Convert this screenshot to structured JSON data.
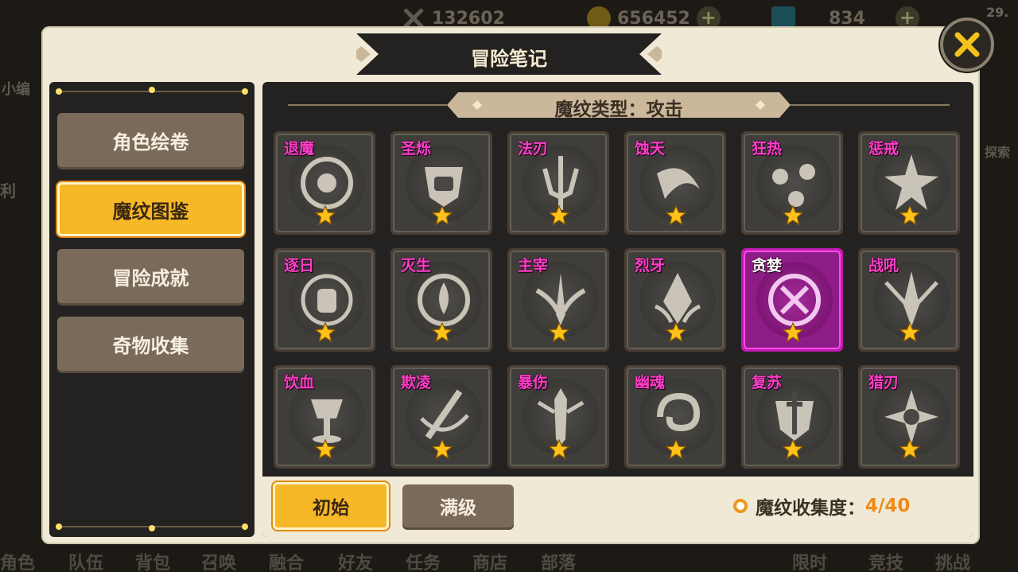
{
  "background": {
    "resources": [
      {
        "icon": "crossed-swords-icon",
        "value": "132602"
      },
      {
        "icon": "coin-icon",
        "value": "656452"
      },
      {
        "icon": "gem-icon",
        "value": "834"
      }
    ],
    "top_right_text": "29.",
    "left_texts": [
      "小编",
      "利"
    ],
    "right_text": "探索",
    "bottom_nav": [
      "角色",
      "队伍",
      "背包",
      "召唤",
      "融合",
      "好友",
      "任务",
      "商店",
      "部落",
      "限时",
      "竞技",
      "挑战"
    ]
  },
  "dialog": {
    "title": "冒险笔记",
    "close_icon": "crossed-swords-close-icon",
    "menu": [
      {
        "label": "角色绘卷",
        "active": false
      },
      {
        "label": "魔纹图鉴",
        "active": true
      },
      {
        "label": "冒险成就",
        "active": false
      },
      {
        "label": "奇物收集",
        "active": false
      }
    ],
    "type_label": "魔纹类型：攻击",
    "runes": [
      {
        "name": "退魔",
        "icon": "vortex-rune-icon",
        "stars": 1
      },
      {
        "name": "圣烁",
        "icon": "fist-shield-rune-icon",
        "stars": 1
      },
      {
        "name": "法刃",
        "icon": "trident-rune-icon",
        "stars": 1
      },
      {
        "name": "蚀天",
        "icon": "crescent-blade-rune-icon",
        "stars": 1
      },
      {
        "name": "狂热",
        "icon": "orbs-rune-icon",
        "stars": 1
      },
      {
        "name": "惩戒",
        "icon": "burst-rune-icon",
        "stars": 1
      },
      {
        "name": "逐日",
        "icon": "sun-fist-rune-icon",
        "stars": 1
      },
      {
        "name": "灭生",
        "icon": "flame-ring-rune-icon",
        "stars": 1
      },
      {
        "name": "主宰",
        "icon": "winged-sword-rune-icon",
        "stars": 1
      },
      {
        "name": "烈牙",
        "icon": "fang-rune-icon",
        "stars": 1
      },
      {
        "name": "贪婪",
        "icon": "claw-ring-rune-icon",
        "stars": 1
      },
      {
        "name": "战吼",
        "icon": "spear-wing-rune-icon",
        "stars": 1
      },
      {
        "name": "饮血",
        "icon": "chalice-rune-icon",
        "stars": 1
      },
      {
        "name": "欺凌",
        "icon": "slash-sword-rune-icon",
        "stars": 1
      },
      {
        "name": "暴伤",
        "icon": "spiked-sword-rune-icon",
        "stars": 1
      },
      {
        "name": "幽魂",
        "icon": "swirl-ghost-rune-icon",
        "stars": 1
      },
      {
        "name": "复苏",
        "icon": "cross-shield-rune-icon",
        "stars": 1
      },
      {
        "name": "猎刃",
        "icon": "shuriken-rune-icon",
        "stars": 1
      }
    ],
    "selected_rune": "贪婪",
    "footer": {
      "btn_initial": "初始",
      "btn_max": "满级",
      "collection_label": "魔纹收集度：",
      "collection_value": "4/40"
    }
  }
}
